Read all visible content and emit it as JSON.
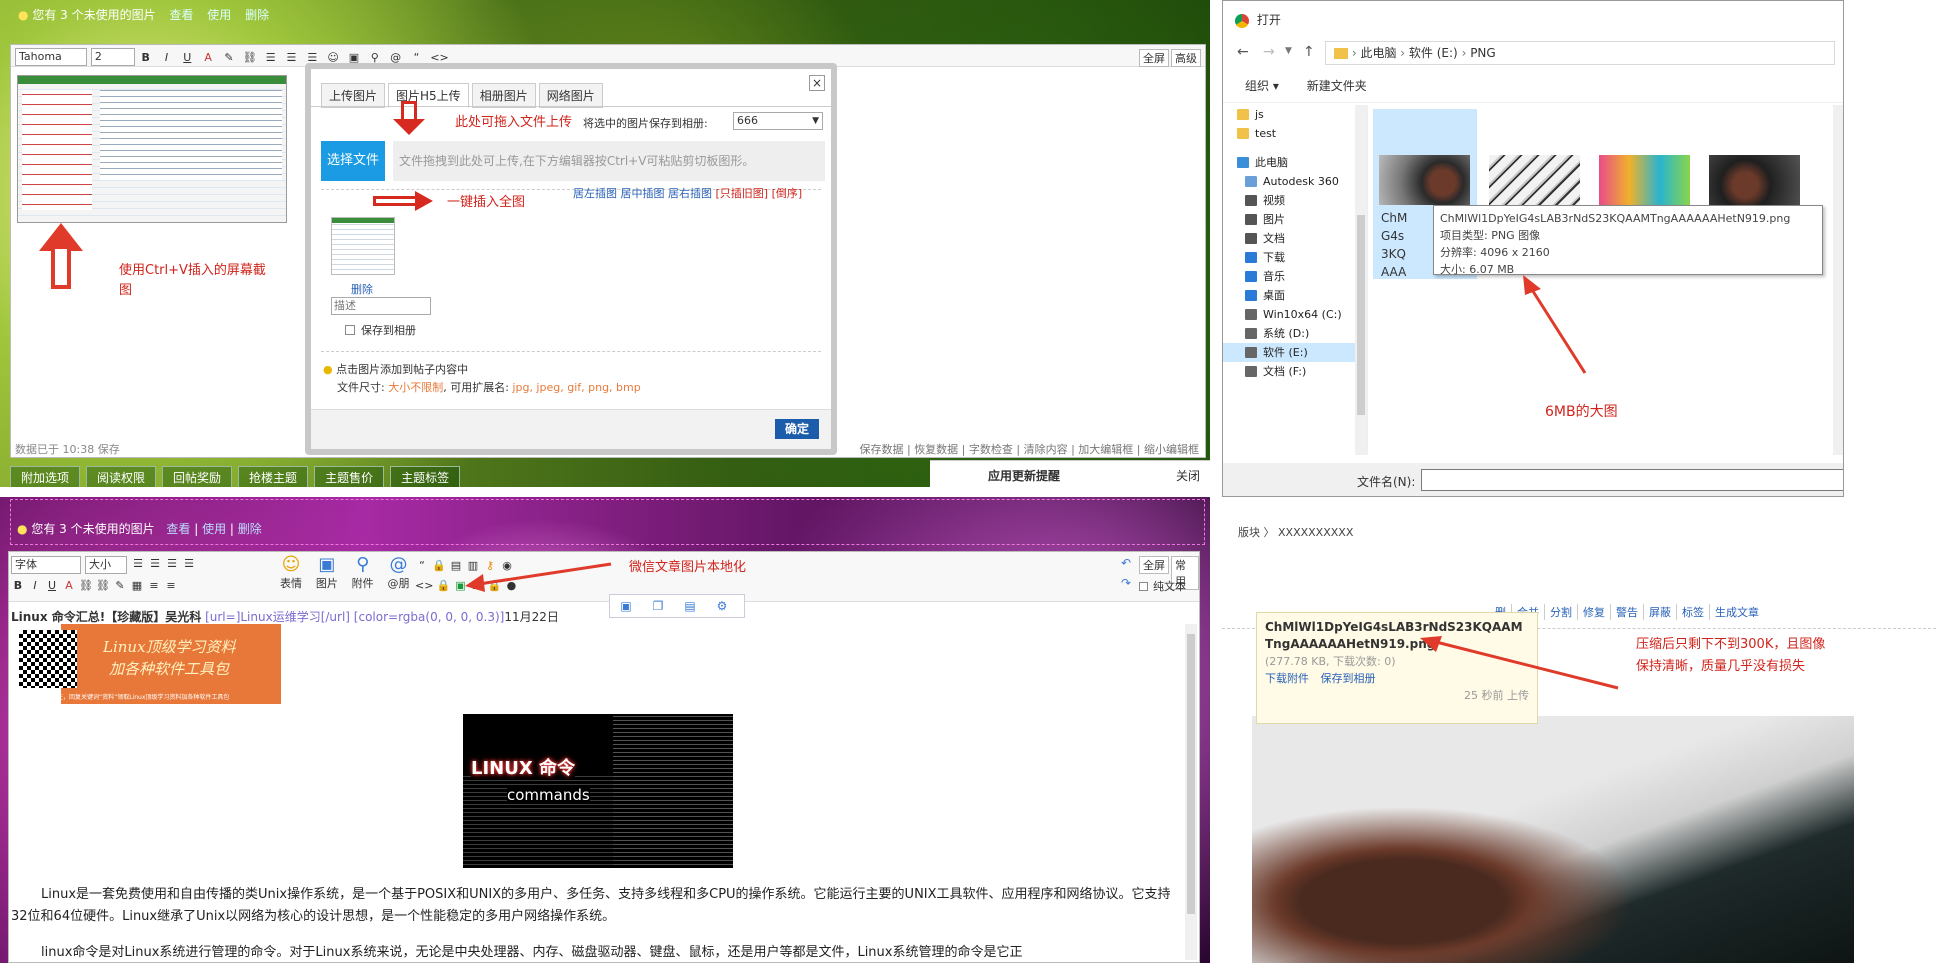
{
  "q1": {
    "notice": "您有 3 个未使用的图片",
    "notice_links": [
      "查看",
      "使用",
      "删除"
    ],
    "font": "Tahoma",
    "size": "2",
    "fullscreen": "全屏",
    "advanced": "高级",
    "tabs": [
      "上传图片",
      "图片H5上传",
      "相册图片",
      "网络图片"
    ],
    "drag_hint": "此处可拖入文件上传",
    "save_to_album_label": "将选中的图片保存到相册:",
    "album_value": "666",
    "select_file": "选择文件",
    "drop_placeholder": "文件拖拽到此处可上传,在下方编辑器按Ctrl+V可粘贴剪切板图形。",
    "insert_all_hint": "一键插入全图",
    "insert_links": [
      "居左插图",
      "居中插图",
      "居右插图"
    ],
    "insert_red": "[只插旧图] [倒序]",
    "delete": "删除",
    "desc_placeholder": "描述",
    "save_album": "保存到相册",
    "tip": "点击图片添加到帖子内容中",
    "file_size_label": "文件尺寸:",
    "file_size_value": "大小不限制",
    "ext_label": ", 可用扩展名:",
    "ext_value": "jpg, jpeg, gif, png, bmp",
    "confirm": "确定",
    "ctrlv_hint": "使用Ctrl+V插入的屏幕截图",
    "saved": "数据已于 10:38 保存",
    "footer_links": [
      "保存数据",
      "恢复数据",
      "字数检查",
      "清除内容",
      "加大编辑框",
      "缩小编辑框"
    ],
    "bottom_tabs": [
      "附加选项",
      "阅读权限",
      "回帖奖励",
      "抢楼主题",
      "主题售价",
      "主题标签"
    ],
    "update_notice": "应用更新提醒",
    "close": "关闭"
  },
  "q2": {
    "title": "打开",
    "breadcrumb": [
      "此电脑",
      "软件 (E:)",
      "PNG"
    ],
    "organize": "组织",
    "new_folder": "新建文件夹",
    "tree": [
      {
        "label": "js",
        "color": "#f0c24a"
      },
      {
        "label": "test",
        "color": "#f0c24a"
      },
      {
        "label": "此电脑",
        "color": "#3b8ed8"
      },
      {
        "label": "Autodesk 360",
        "color": "#6a9fd8"
      },
      {
        "label": "视频",
        "color": "#555"
      },
      {
        "label": "图片",
        "color": "#555"
      },
      {
        "label": "文档",
        "color": "#555"
      },
      {
        "label": "下载",
        "color": "#2a7bd8"
      },
      {
        "label": "音乐",
        "color": "#2a7bd8"
      },
      {
        "label": "桌面",
        "color": "#2a7bd8"
      },
      {
        "label": "Win10x64 (C:)",
        "color": "#666"
      },
      {
        "label": "系统 (D:)",
        "color": "#666"
      },
      {
        "label": "软件 (E:)",
        "color": "#666"
      },
      {
        "label": "文档 (F:)",
        "color": "#666"
      }
    ],
    "selected_tree": "软件 (E:)",
    "file_label_partial": [
      "ChM",
      "G4s",
      "3KQ",
      "AAA"
    ],
    "tooltip": {
      "name": "ChMlWl1DpYeIG4sLAB3rNdS23KQAAMTngAAAAAAHetN919.png",
      "type": "项目类型: PNG 图像",
      "res": "分辨率: 4096 x 2160",
      "size": "大小: 6.07 MB"
    },
    "big_note": "6MB的大图",
    "filename_label": "文件名(N):"
  },
  "q3": {
    "notice": "您有 3 个未使用的图片",
    "notice_links": [
      "查看",
      "使用",
      "删除"
    ],
    "font": "字体",
    "size": "大小",
    "fullscreen": "全屏",
    "common": "常用",
    "plain": "纯文本",
    "icon_labels": [
      "表情",
      "图片",
      "附件",
      "@朋"
    ],
    "wx_hint": "微信文章图片本地化",
    "title_line": "Linux 命令汇总!【珍藏版】吴光科",
    "title_bb": "[url=]Linux运维学习[/url] [color=rgba(0, 0, 0, 0.3)]",
    "title_date": "11月22日",
    "banner_top": "Linux顶级学习资料",
    "banner_mid": "加各种软件工具包",
    "banner_caption": "识别二维码，关注，回复关键词“资料”领取Linux顶级学习资料加各种软件工具包",
    "linux_logo": "LINUX 命令",
    "linux_sub": "commands",
    "para1": "Linux是一套免费使用和自由传播的类Unix操作系统，是一个基于POSIX和UNIX的多用户、多任务、支持多线程和多CPU的操作系统。它能运行主要的UNIX工具软件、应用程序和网络协议。它支持32位和64位硬件。Linux继承了Unix以网络为核心的设计思想，是一个性能稳定的多用户网络操作系统。",
    "para2": "linux命令是对Linux系统进行管理的命令。对于Linux系统来说，无论是中央处理器、内存、磁盘驱动器、键盘、鼠标，还是用户等都是文件，Linux系统管理的命令是它正"
  },
  "q4": {
    "crumb": [
      "版块",
      "XXXXXXXXXX"
    ],
    "actions": [
      "删",
      "合并",
      "分割",
      "修复",
      "警告",
      "屏蔽",
      "标签",
      "生成文章"
    ],
    "file_name": "ChMlWl1DpYeIG4sLAB3rNdS23KQAAMTngAAAAAAHetN919.png",
    "file_meta": "(277.78 KB, 下载次数: 0)",
    "download": "下载附件",
    "save_album": "保存到相册",
    "uploaded": "25 秒前 上传",
    "note": "压缩后只剩下不到300K，且图像保持清晰，质量几乎没有损失"
  }
}
